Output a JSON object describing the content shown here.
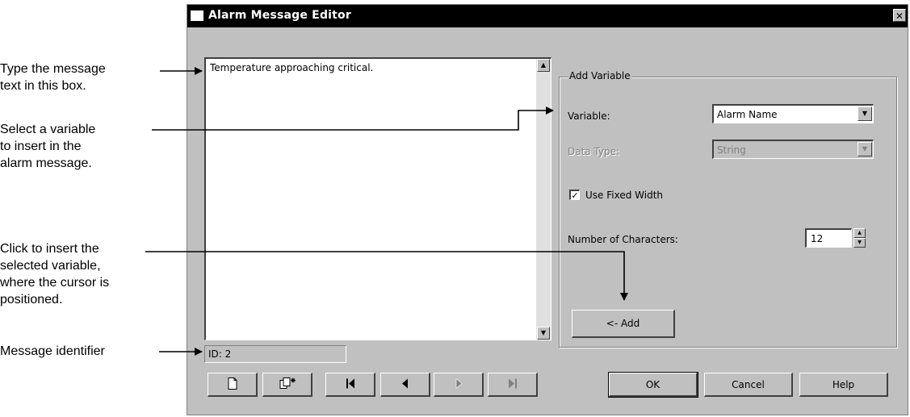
{
  "callouts": {
    "message_text": [
      "Type the message",
      "text in this box."
    ],
    "select_variable": [
      "Select a variable",
      "to insert in the",
      "alarm message."
    ],
    "click_insert": [
      "Click to insert the",
      "selected variable,",
      "where the cursor is",
      "positioned."
    ],
    "message_identifier": "Message identifier"
  },
  "dialog": {
    "title": "Alarm Message Editor",
    "close_glyph": "✕",
    "message_text": "Temperature approaching critical.",
    "id_label": "ID: 2",
    "group_label": "Add Variable",
    "variable_label": "Variable:",
    "variable_value": "Alarm Name",
    "datatype_label": "Data Type:",
    "datatype_value": "String",
    "fixed_width_checked": true,
    "fixed_width_label": "Use Fixed Width",
    "num_chars_label": "Number of Characters:",
    "num_chars_value": "12",
    "add_label": "<- Add",
    "ok_label": "OK",
    "cancel_label": "Cancel",
    "help_label": "Help"
  },
  "icons": {
    "new": "new-document-icon",
    "copy": "copy-record-icon",
    "first": "first-record-icon",
    "prev": "previous-record-icon",
    "next": "next-record-icon",
    "last": "last-record-icon"
  }
}
